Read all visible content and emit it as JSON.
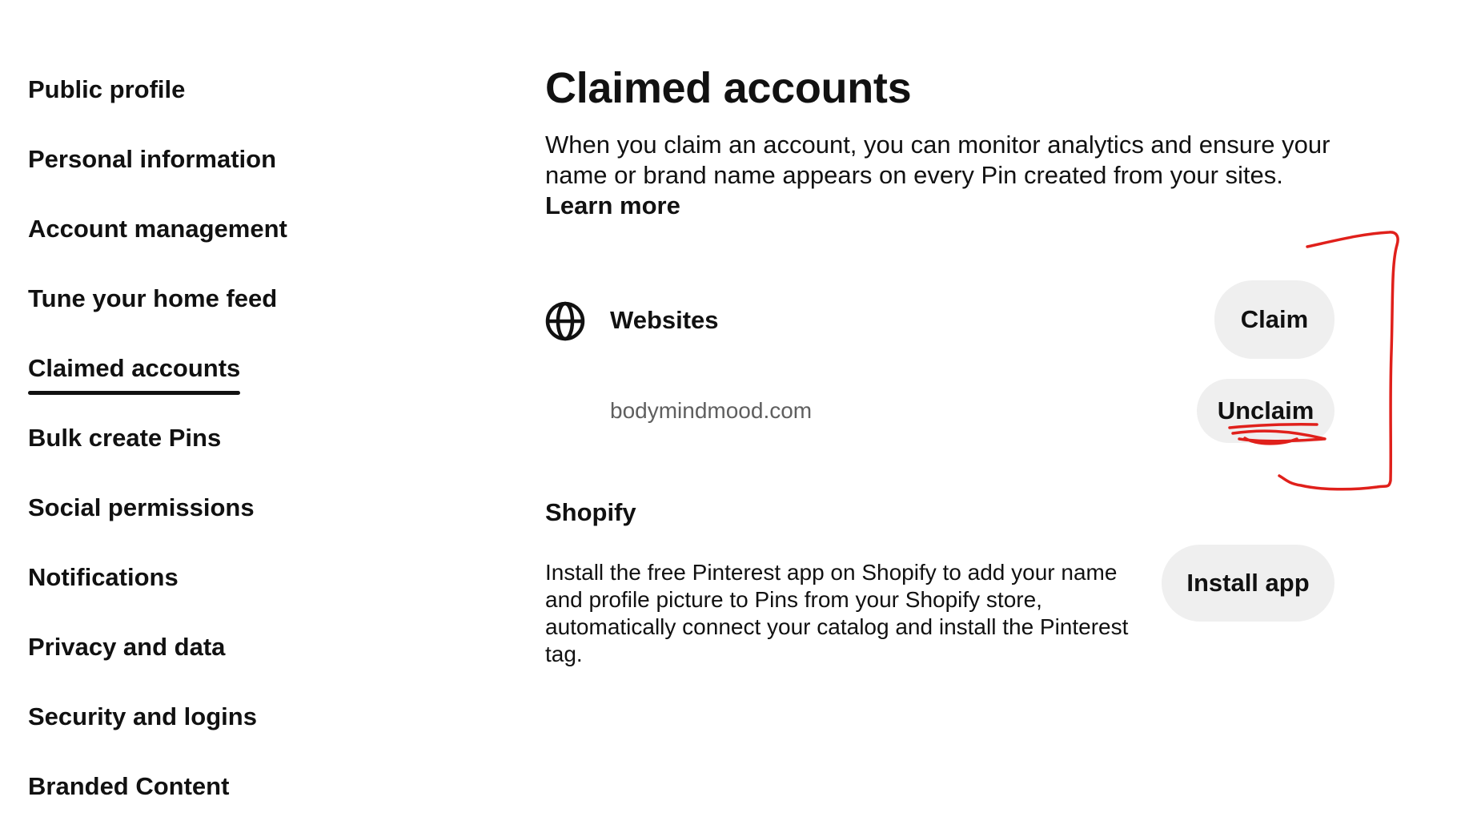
{
  "sidebar": {
    "items": [
      {
        "label": "Public profile"
      },
      {
        "label": "Personal information"
      },
      {
        "label": "Account management"
      },
      {
        "label": "Tune your home feed"
      },
      {
        "label": "Claimed accounts",
        "active": true
      },
      {
        "label": "Bulk create Pins"
      },
      {
        "label": "Social permissions"
      },
      {
        "label": "Notifications"
      },
      {
        "label": "Privacy and data"
      },
      {
        "label": "Security and logins"
      },
      {
        "label": "Branded Content"
      }
    ]
  },
  "main": {
    "title": "Claimed accounts",
    "description": "When you claim an account, you can monitor analytics and ensure your name or brand name appears on every Pin created from your sites.",
    "learn_more": "Learn more",
    "websites": {
      "icon": "globe-icon",
      "label": "Websites",
      "claim_label": "Claim",
      "site": "bodymindmood.com",
      "unclaim_label": "Unclaim"
    },
    "shopify": {
      "title": "Shopify",
      "description": "Install the free Pinterest app on Shopify to add your name and profile picture to Pins from your Shopify store, automatically connect your catalog and install the Pinterest tag.",
      "install_label": "Install app"
    }
  },
  "colors": {
    "text": "#111111",
    "muted": "#5f5f5f",
    "button_bg": "#efefef",
    "annotation": "#e0201b"
  }
}
